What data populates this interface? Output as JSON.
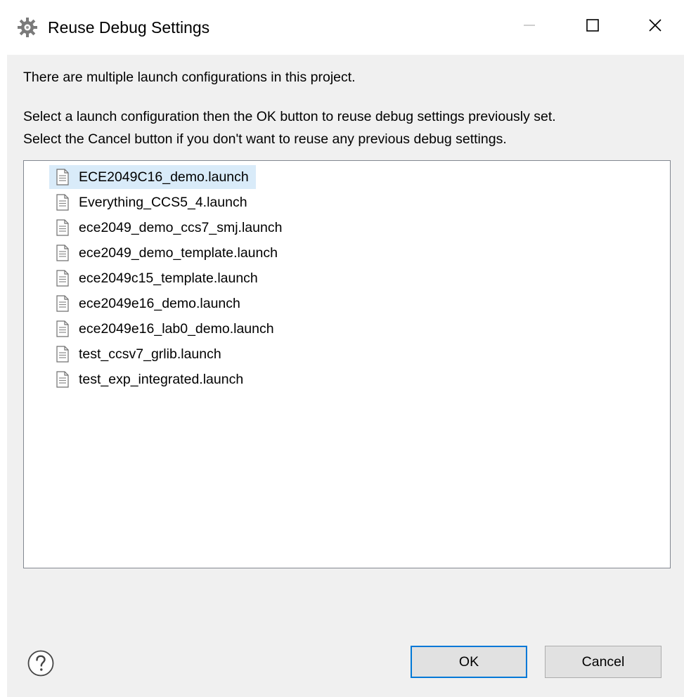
{
  "window": {
    "title": "Reuse Debug Settings",
    "icon": "gear-icon"
  },
  "controls": {
    "minimize_icon": "minimize-icon",
    "maximize_icon": "maximize-icon",
    "close_icon": "close-icon"
  },
  "message": {
    "line1": "There are multiple launch configurations in this project.",
    "line2": "Select a launch configuration then the OK button to reuse debug settings previously set.",
    "line3": "Select the Cancel button if you don't want to reuse any previous debug settings."
  },
  "launch_list": {
    "selected_index": 0,
    "items": [
      {
        "label": "ECE2049C16_demo.launch",
        "icon": "file-icon"
      },
      {
        "label": "Everything_CCS5_4.launch",
        "icon": "file-icon"
      },
      {
        "label": "ece2049_demo_ccs7_smj.launch",
        "icon": "file-icon"
      },
      {
        "label": "ece2049_demo_template.launch",
        "icon": "file-icon"
      },
      {
        "label": "ece2049c15_template.launch",
        "icon": "file-icon"
      },
      {
        "label": "ece2049e16_demo.launch",
        "icon": "file-icon"
      },
      {
        "label": "ece2049e16_lab0_demo.launch",
        "icon": "file-icon"
      },
      {
        "label": "test_ccsv7_grlib.launch",
        "icon": "file-icon"
      },
      {
        "label": "test_exp_integrated.launch",
        "icon": "file-icon"
      }
    ]
  },
  "footer": {
    "help_icon": "help-icon",
    "ok_label": "OK",
    "cancel_label": "Cancel"
  },
  "colors": {
    "selection": "#d9ebf9",
    "dialog_bg": "#f0f0f0",
    "default_button_border": "#0078d7",
    "list_border": "#828790"
  }
}
